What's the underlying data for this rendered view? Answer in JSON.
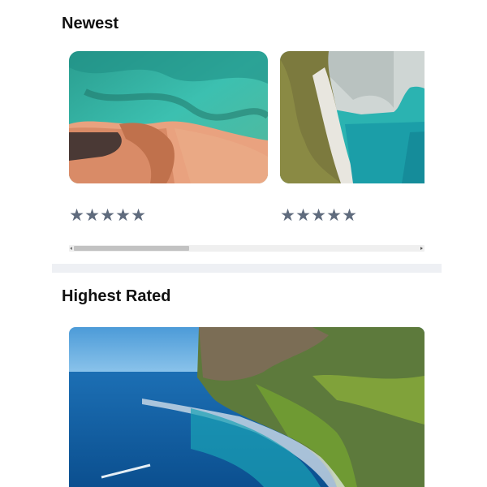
{
  "sections": {
    "newest": {
      "title": "Newest",
      "cards": [
        {
          "image": "aerial-beach-photo",
          "stars": "★★★★★",
          "rating": 5
        },
        {
          "image": "sea-arch-cliff-photo",
          "stars": "★★★★★",
          "rating": 5
        }
      ],
      "scroll_position": 0.0
    },
    "highest_rated": {
      "title": "Highest Rated",
      "featured": {
        "image": "coastal-headland-photo"
      }
    }
  },
  "colors": {
    "star": "#5f6b7d",
    "divider": "#eef0f4",
    "scroll_track": "#efefef",
    "scroll_thumb": "#c2c2c2"
  }
}
